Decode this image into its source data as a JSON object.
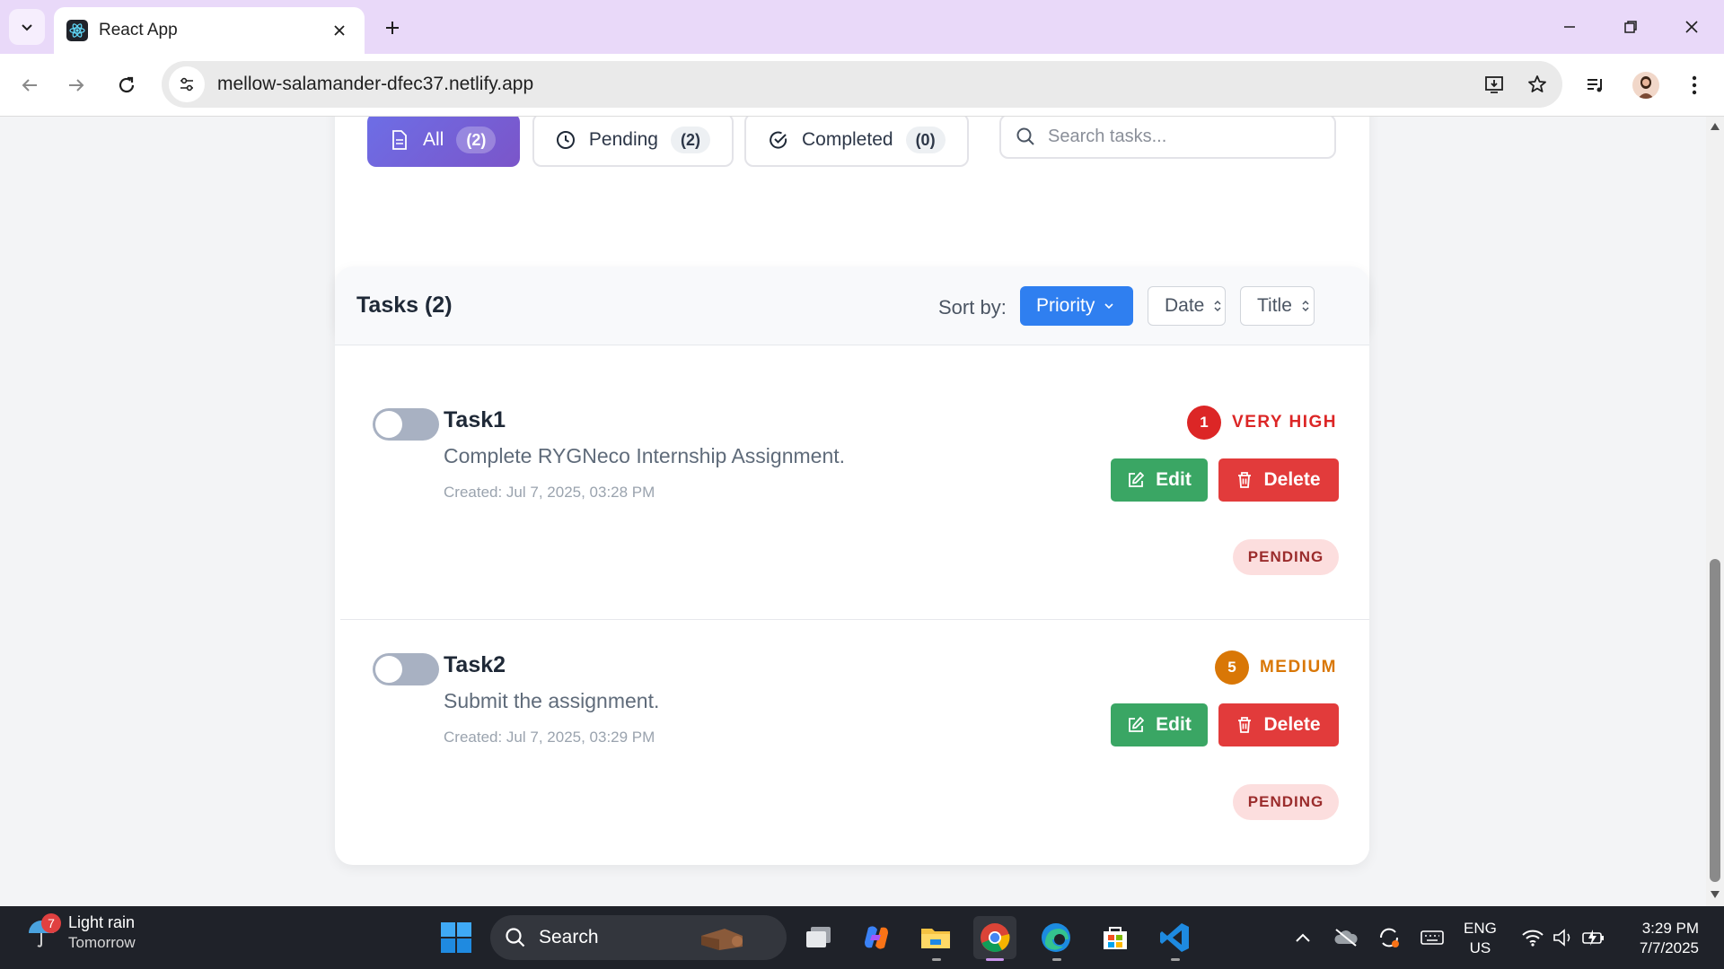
{
  "browser": {
    "tab_title": "React App",
    "url": "mellow-salamander-dfec37.netlify.app",
    "icons": {
      "tab_menu": "chevron-down-icon",
      "close_tab": "close-icon",
      "new_tab": "plus-icon",
      "back": "arrow-left-icon",
      "forward": "arrow-right-icon",
      "reload": "reload-icon",
      "site_info": "tune-icon",
      "install": "install-icon",
      "bookmark": "star-icon",
      "media": "media-queue-icon",
      "menu": "kebab-icon"
    }
  },
  "filters": {
    "items": [
      {
        "label": "All",
        "count": "(2)",
        "icon": "document-icon",
        "active": true
      },
      {
        "label": "Pending",
        "count": "(2)",
        "icon": "clock-icon",
        "active": false
      },
      {
        "label": "Completed",
        "count": "(0)",
        "icon": "check-circle-icon",
        "active": false
      }
    ],
    "search_placeholder": "Search tasks..."
  },
  "tasks_panel": {
    "title": "Tasks (2)",
    "sort_label": "Sort by:",
    "sort_options": [
      {
        "label": "Priority",
        "active": true
      },
      {
        "label": "Date",
        "active": false
      },
      {
        "label": "Title",
        "active": false
      }
    ]
  },
  "tasks": [
    {
      "title": "Task1",
      "description": "Complete RYGNeco Internship Assignment.",
      "created": "Created: Jul 7, 2025, 03:28 PM",
      "priority_num": "1",
      "priority_label": "VERY HIGH",
      "priority_color": "#dc2626",
      "edit_label": "Edit",
      "delete_label": "Delete",
      "status": "PENDING"
    },
    {
      "title": "Task2",
      "description": "Submit the assignment.",
      "created": "Created: Jul 7, 2025, 03:29 PM",
      "priority_num": "5",
      "priority_label": "MEDIUM",
      "priority_color": "#d97706",
      "edit_label": "Edit",
      "delete_label": "Delete",
      "status": "PENDING"
    }
  ],
  "taskbar": {
    "weather_badge": "7",
    "weather_main": "Light rain",
    "weather_sub": "Tomorrow",
    "search_label": "Search",
    "lang_line1": "ENG",
    "lang_line2": "US",
    "time": "3:29 PM",
    "date": "7/7/2025"
  },
  "colors": {
    "accent": "#2f7ff0",
    "edit": "#3aa664",
    "delete": "#e23b3b",
    "filter_active": "#6d6ee6"
  }
}
